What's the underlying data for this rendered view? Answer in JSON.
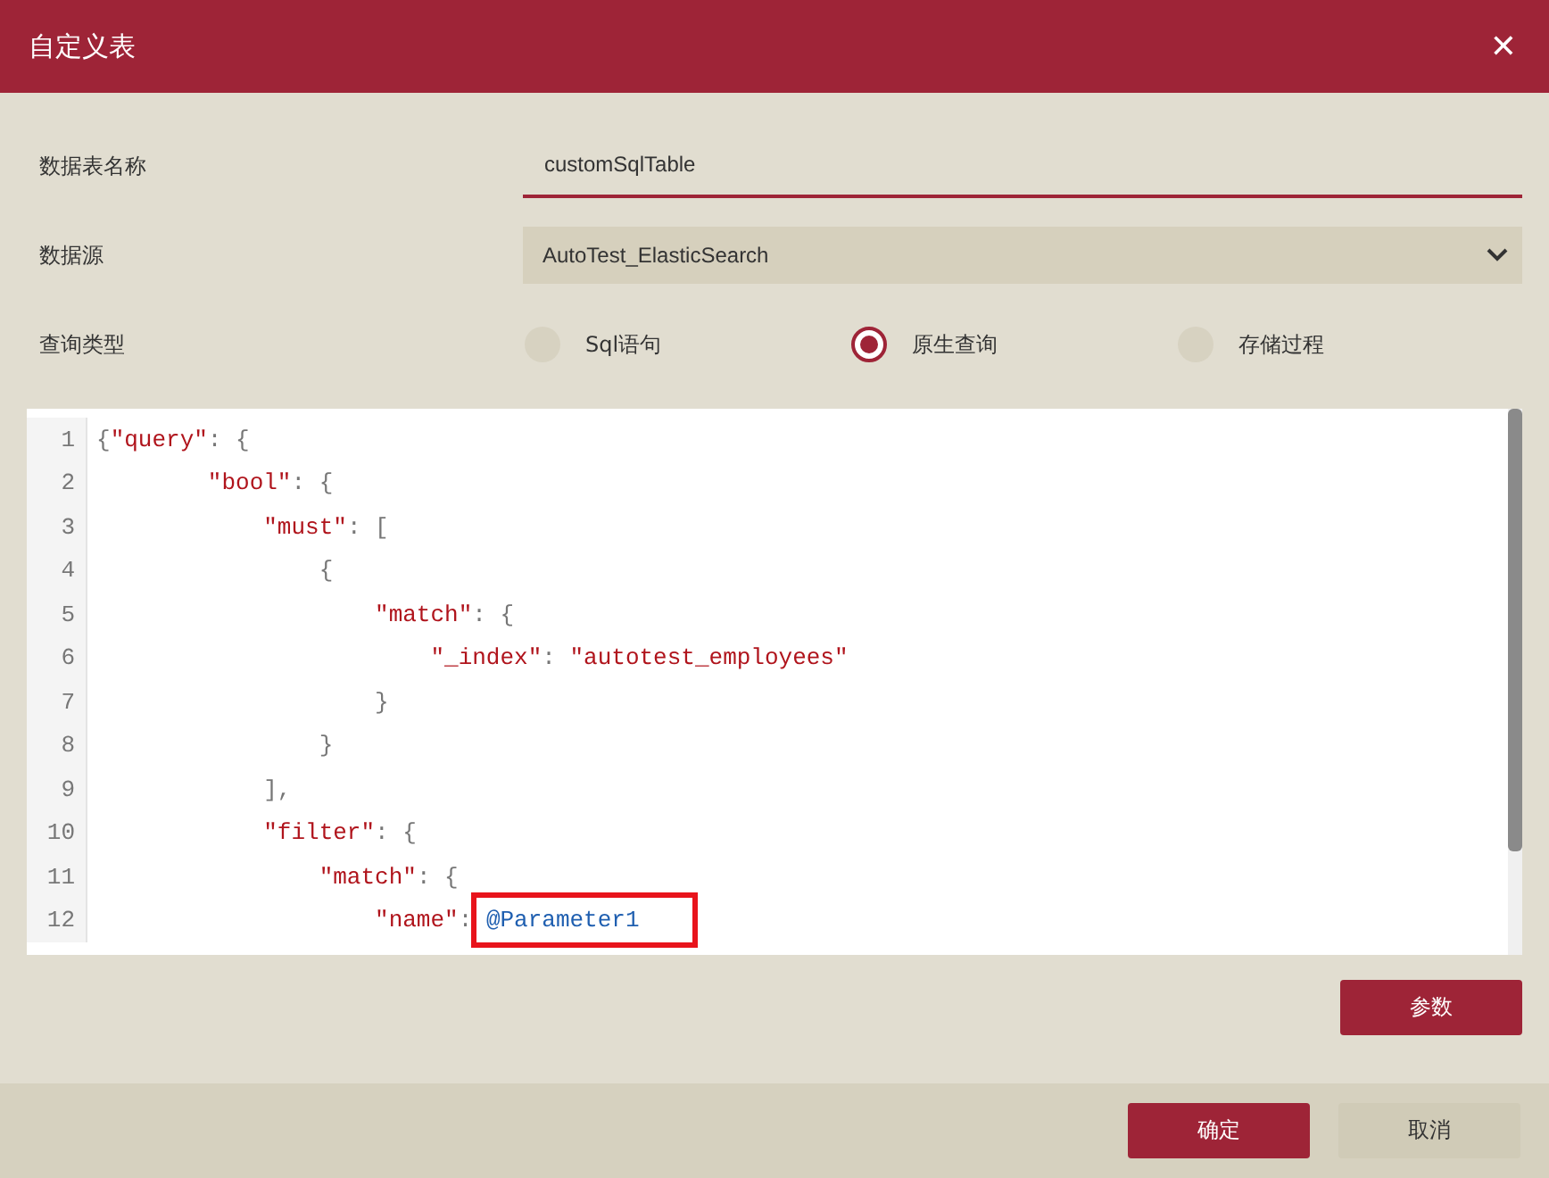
{
  "window": {
    "title": "自定义表",
    "close": "✕"
  },
  "fields": [
    {
      "kind": "input",
      "label": "数据表名称",
      "value": "customSqlTable"
    },
    {
      "kind": "select",
      "label": "数据源",
      "value": "AutoTest_ElasticSearch"
    },
    {
      "kind": "radio",
      "label": "查询类型",
      "options": [
        {
          "label": "Sql语句",
          "selected": false
        },
        {
          "label": "原生查询",
          "selected": true
        },
        {
          "label": "存储过程",
          "selected": false
        }
      ]
    }
  ],
  "editor": {
    "lines": [
      {
        "number": "1",
        "tokens": [
          {
            "kind": "punct",
            "text": "{"
          },
          {
            "kind": "key",
            "text": "\"query\""
          },
          {
            "kind": "punct",
            "text": ": {"
          }
        ]
      },
      {
        "number": "2",
        "tokens": [
          {
            "kind": "key",
            "text": "        \"bool\""
          },
          {
            "kind": "punct",
            "text": ": {"
          }
        ]
      },
      {
        "number": "3",
        "tokens": [
          {
            "kind": "key",
            "text": "            \"must\""
          },
          {
            "kind": "punct",
            "text": ": ["
          }
        ]
      },
      {
        "number": "4",
        "tokens": [
          {
            "kind": "punct",
            "text": "                {"
          }
        ]
      },
      {
        "number": "5",
        "tokens": [
          {
            "kind": "key",
            "text": "                    \"match\""
          },
          {
            "kind": "punct",
            "text": ": {"
          }
        ]
      },
      {
        "number": "6",
        "tokens": [
          {
            "kind": "key",
            "text": "                        \"_index\""
          },
          {
            "kind": "punct",
            "text": ": "
          },
          {
            "kind": "key",
            "text": "\"autotest_employees\""
          }
        ]
      },
      {
        "number": "7",
        "tokens": [
          {
            "kind": "punct",
            "text": "                    }"
          }
        ]
      },
      {
        "number": "8",
        "tokens": [
          {
            "kind": "punct",
            "text": "                }"
          }
        ]
      },
      {
        "number": "9",
        "tokens": [
          {
            "kind": "punct",
            "text": "            ],"
          }
        ]
      },
      {
        "number": "10",
        "tokens": [
          {
            "kind": "key",
            "text": "            \"filter\""
          },
          {
            "kind": "punct",
            "text": ": {"
          }
        ]
      },
      {
        "number": "11",
        "tokens": [
          {
            "kind": "key",
            "text": "                \"match\""
          },
          {
            "kind": "punct",
            "text": ": {"
          }
        ]
      },
      {
        "number": "12",
        "tokens": [
          {
            "kind": "key",
            "text": "                    \"name\""
          },
          {
            "kind": "punct",
            "text": ": "
          },
          {
            "kind": "param",
            "text": "@Parameter1",
            "highlighted": true
          }
        ]
      }
    ]
  },
  "params_button": "参数",
  "buttons": [
    {
      "label": "确定",
      "kind": "primary"
    },
    {
      "label": "取消",
      "kind": "secondary"
    }
  ]
}
